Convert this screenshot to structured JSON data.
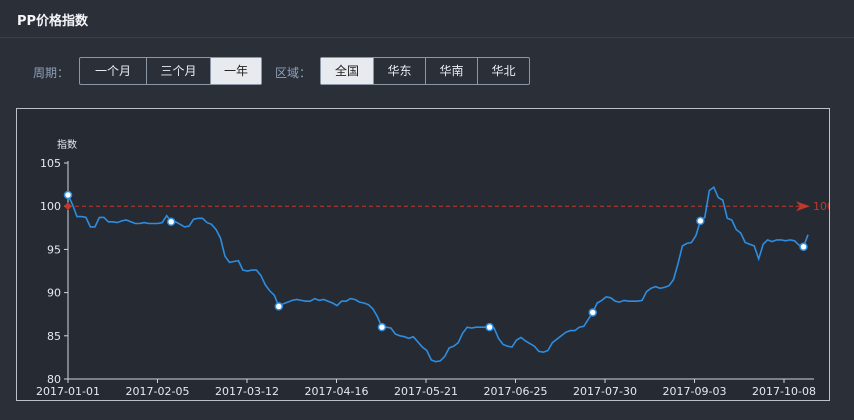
{
  "header": {
    "title": "PP价格指数"
  },
  "filters": {
    "period_label": "周期：",
    "periods": [
      {
        "label": "一个月",
        "active": false
      },
      {
        "label": "三个月",
        "active": false
      },
      {
        "label": "一年",
        "active": true
      }
    ],
    "region_label": "区域：",
    "regions": [
      {
        "label": "全国",
        "active": true
      },
      {
        "label": "华东",
        "active": false
      },
      {
        "label": "华南",
        "active": false
      },
      {
        "label": "华北",
        "active": false
      }
    ]
  },
  "colors": {
    "line": "#2e8de0",
    "reference": "#c0392b",
    "axis": "#cfd5dd",
    "text": "#e6e9ee"
  },
  "chart_data": {
    "type": "line",
    "ylabel": "指数",
    "ylim": [
      80,
      105
    ],
    "yticks": [
      80,
      85,
      90,
      95,
      100,
      105
    ],
    "x_tick_labels": [
      "2017-01-01",
      "2017-02-05",
      "2017-03-12",
      "2017-04-16",
      "2017-05-21",
      "2017-06-25",
      "2017-07-30",
      "2017-09-03",
      "2017-10-08"
    ],
    "reference_line": {
      "value": 100,
      "label": "100"
    },
    "series": [
      {
        "values": [
          101.3,
          100.2,
          98.8,
          98.8,
          98.7,
          97.6,
          97.6,
          98.7,
          98.7,
          98.2,
          98.2,
          98.1,
          98.3,
          98.4,
          98.2,
          98.0,
          98.0,
          98.1,
          98.0,
          98.0,
          98.0,
          98.1,
          98.9,
          98.2,
          98.2,
          97.9,
          97.6,
          97.7,
          98.5,
          98.6,
          98.6,
          98.1,
          97.9,
          97.3,
          96.3,
          94.2,
          93.5,
          93.6,
          93.7,
          92.6,
          92.5,
          92.6,
          92.6,
          92.0,
          90.9,
          90.2,
          89.7,
          88.4,
          88.7,
          88.9,
          89.1,
          89.2,
          89.1,
          89.0,
          89.0,
          89.3,
          89.1,
          89.2,
          89.0,
          88.8,
          88.5,
          89.0,
          89.0,
          89.3,
          89.2,
          88.9,
          88.8,
          88.6,
          88.1,
          87.2,
          86.0,
          86.0,
          85.9,
          85.2,
          85.0,
          84.9,
          84.7,
          84.9,
          84.3,
          83.7,
          83.3,
          82.2,
          82.0,
          82.1,
          82.6,
          83.6,
          83.8,
          84.2,
          85.3,
          86.0,
          85.9,
          86.0,
          86.0,
          86.0,
          86.0,
          85.9,
          84.7,
          84.0,
          83.8,
          83.7,
          84.5,
          84.8,
          84.4,
          84.1,
          83.8,
          83.2,
          83.1,
          83.3,
          84.2,
          84.6,
          85.0,
          85.4,
          85.6,
          85.6,
          86.0,
          86.1,
          86.9,
          87.7,
          88.8,
          89.1,
          89.5,
          89.4,
          89.0,
          88.9,
          89.1,
          89.0,
          89.0,
          89.0,
          89.1,
          90.1,
          90.5,
          90.7,
          90.5,
          90.6,
          90.8,
          91.5,
          93.3,
          95.4,
          95.7,
          95.8,
          96.6,
          98.3,
          98.7,
          101.8,
          102.2,
          101.0,
          100.7,
          98.6,
          98.4,
          97.3,
          96.9,
          95.8,
          95.6,
          95.4,
          93.9,
          95.6,
          96.1,
          95.9,
          96.1,
          96.1,
          96.0,
          96.1,
          96.0,
          95.5,
          95.3,
          96.7
        ]
      }
    ]
  }
}
